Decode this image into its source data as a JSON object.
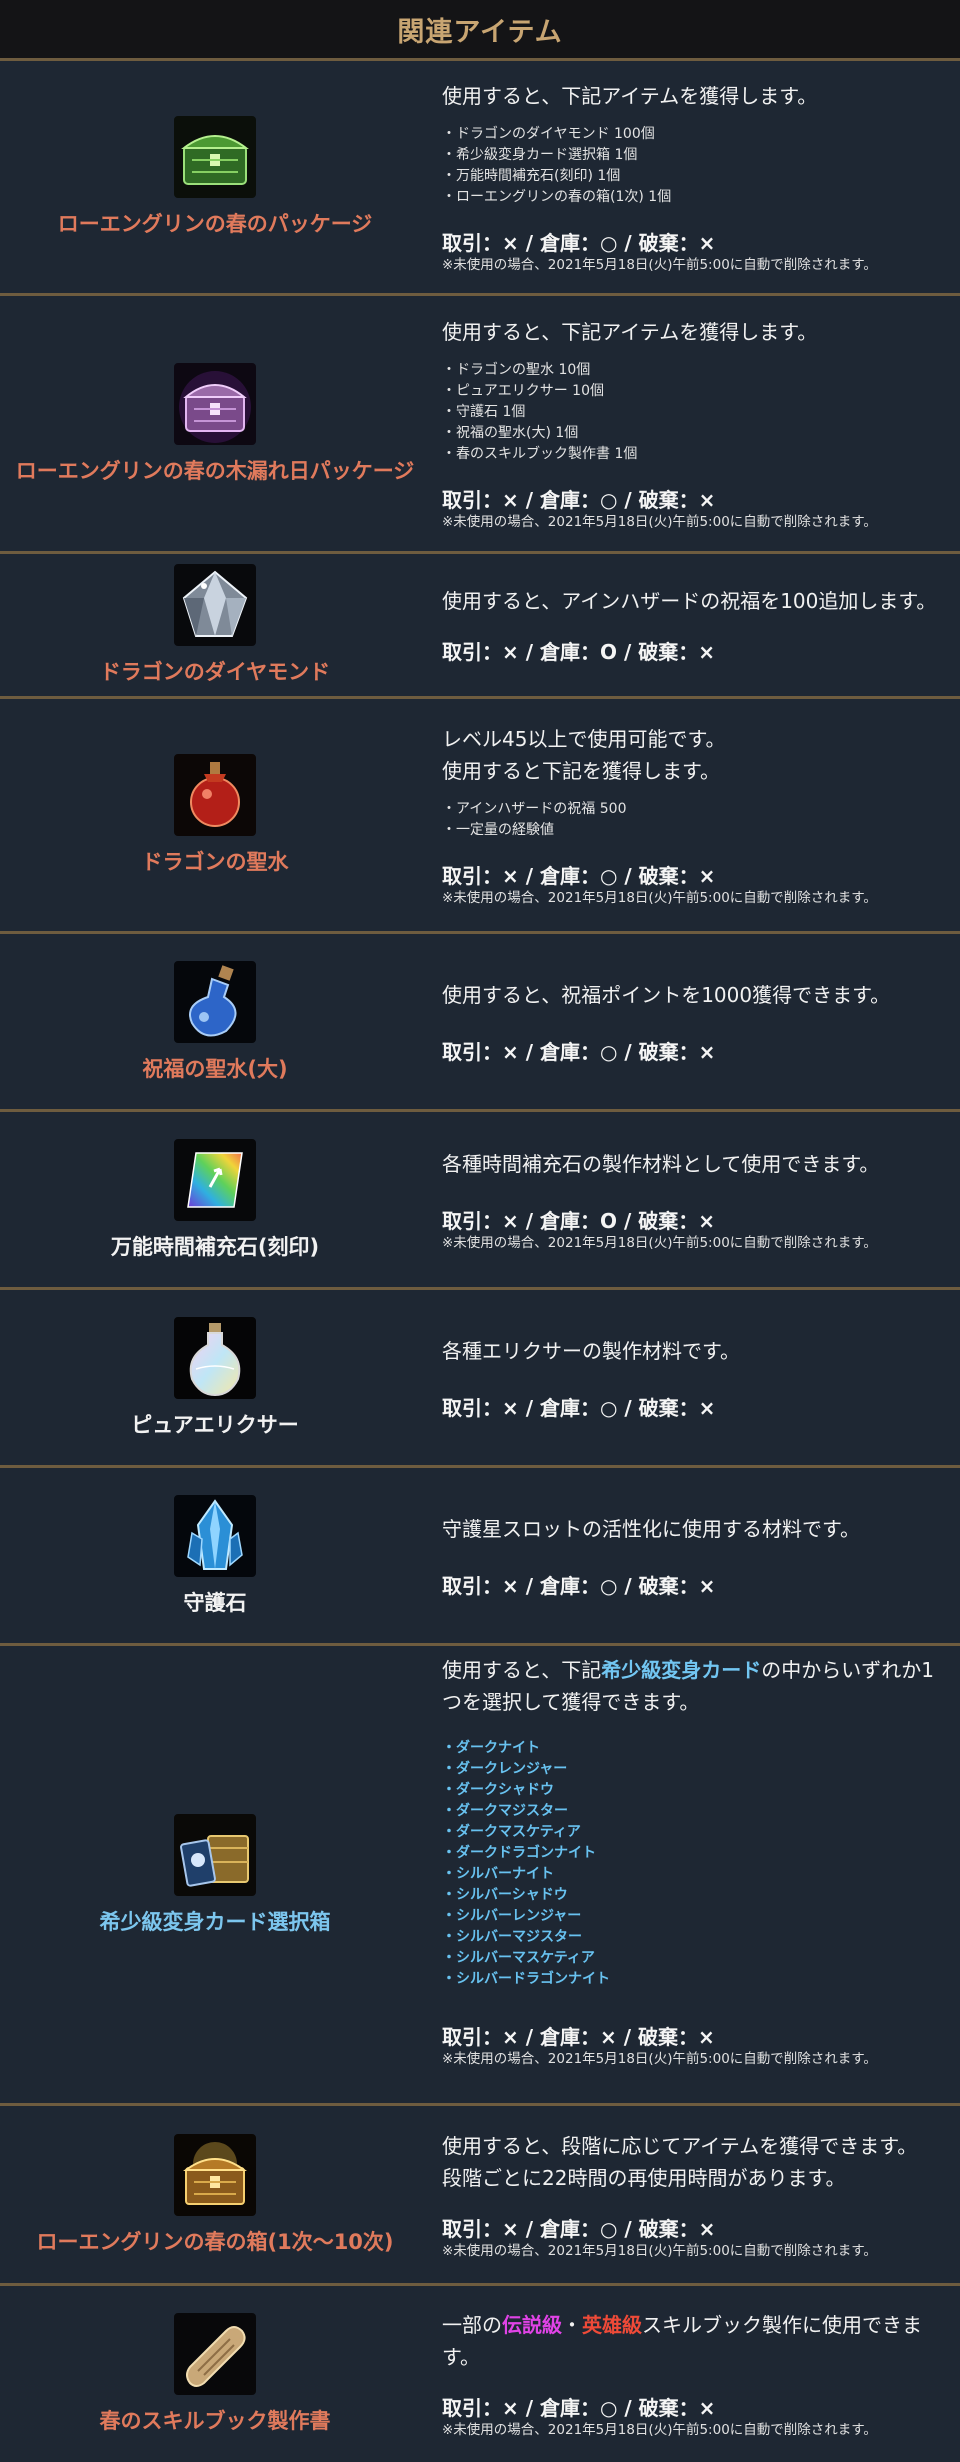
{
  "header": {
    "title": "関連アイテム"
  },
  "colors": {
    "name_orange": "#e07a5c",
    "name_white": "#f2f2f2",
    "name_blue": "#7cc6ee",
    "divider": "#6e5c3f"
  },
  "rows": [
    {
      "name": "ローエングリンの春のパッケージ",
      "icon": "green-treasure-chest",
      "desc": "使用すると、下記アイテムを獲得します。",
      "items": [
        "・ドラゴンのダイヤモンド 100個",
        "・希少級変身カード選択箱 1個",
        "・万能時間補充石(刻印) 1個",
        "・ローエングリンの春の箱(1次) 1個"
      ],
      "trade": "取引：× / 倉庫：○ / 破棄：×",
      "note": "※未使用の場合、2021年5月18日(火)午前5:00に自動で削除されます。"
    },
    {
      "name": "ローエングリンの春の木漏れ日パッケージ",
      "icon": "purple-treasure-chest",
      "desc": "使用すると、下記アイテムを獲得します。",
      "items": [
        "・ドラゴンの聖水 10個",
        "・ピュアエリクサー 10個",
        "・守護石 1個",
        "・祝福の聖水(大) 1個",
        "・春のスキルブック製作書 1個"
      ],
      "trade": "取引：× / 倉庫：○ / 破棄：×",
      "note": "※未使用の場合、2021年5月18日(火)午前5:00に自動で削除されます。"
    },
    {
      "name": "ドラゴンのダイヤモンド",
      "icon": "diamond",
      "desc": "使用すると、アインハザードの祝福を100追加します。",
      "trade": "取引：× / 倉庫：O / 破棄：×"
    },
    {
      "name": "ドラゴンの聖水",
      "icon": "red-potion",
      "desc_lines": [
        "レベル45以上で使用可能です。",
        "使用すると下記を獲得します。"
      ],
      "items": [
        "・アインハザードの祝福 500",
        "・一定量の経験値"
      ],
      "trade": "取引：× / 倉庫：○ / 破棄：×",
      "note": "※未使用の場合、2021年5月18日(火)午前5:00に自動で削除されます。"
    },
    {
      "name": "祝福の聖水(大)",
      "icon": "blue-potion",
      "desc": "使用すると、祝福ポイントを1000獲得できます。",
      "trade": "取引：× / 倉庫：○ / 破棄：×"
    },
    {
      "name": "万能時間補充石(刻印)",
      "icon": "rainbow-stone",
      "desc": "各種時間補充石の製作材料として使用できます。",
      "trade": "取引：× / 倉庫：O / 破棄：×",
      "note": "※未使用の場合、2021年5月18日(火)午前5:00に自動で削除されます。"
    },
    {
      "name": "ピュアエリクサー",
      "icon": "elixir-bottle",
      "desc": "各種エリクサーの製作材料です。",
      "trade": "取引：× / 倉庫：○ / 破棄：×"
    },
    {
      "name": "守護石",
      "icon": "blue-crystal",
      "desc": "守護星スロットの活性化に使用する材料です。",
      "trade": "取引：× / 倉庫：○ / 破棄：×"
    },
    {
      "name": "希少級変身カード選択箱",
      "icon": "card-box",
      "desc_pre": "使用すると、下記",
      "desc_hl": "希少級変身カード",
      "desc_post": "の中からいずれか1つを選択して獲得できます。",
      "items": [
        "・ダークナイト",
        "・ダークレンジャー",
        "・ダークシャドウ",
        "・ダークマジスター",
        "・ダークマスケティア",
        "・ダークドラゴンナイト",
        "・シルバーナイト",
        "・シルバーシャドウ",
        "・シルバーレンジャー",
        "・シルバーマジスター",
        "・シルバーマスケティア",
        "・シルバードラゴンナイト"
      ],
      "trade": "取引：× / 倉庫：× / 破棄：×",
      "note": "※未使用の場合、2021年5月18日(火)午前5:00に自動で削除されます。"
    },
    {
      "name": "ローエングリンの春の箱(1次～10次)",
      "icon": "golden-chest",
      "desc_lines": [
        "使用すると、段階に応じてアイテムを獲得できます。",
        "段階ごとに22時間の再使用時間があります。"
      ],
      "trade": "取引：× / 倉庫：○ / 破棄：×",
      "note": "※未使用の場合、2021年5月18日(火)午前5:00に自動で削除されます。"
    },
    {
      "name": "春のスキルブック製作書",
      "icon": "scroll",
      "desc_pre": "一部の",
      "desc_hl1": "伝説級",
      "desc_mid": "・",
      "desc_hl2": "英雄級",
      "desc_post": "スキルブック製作に使用できます。",
      "trade": "取引：× / 倉庫：○ / 破棄：×",
      "note": "※未使用の場合、2021年5月18日(火)午前5:00に自動で削除されます。"
    }
  ]
}
